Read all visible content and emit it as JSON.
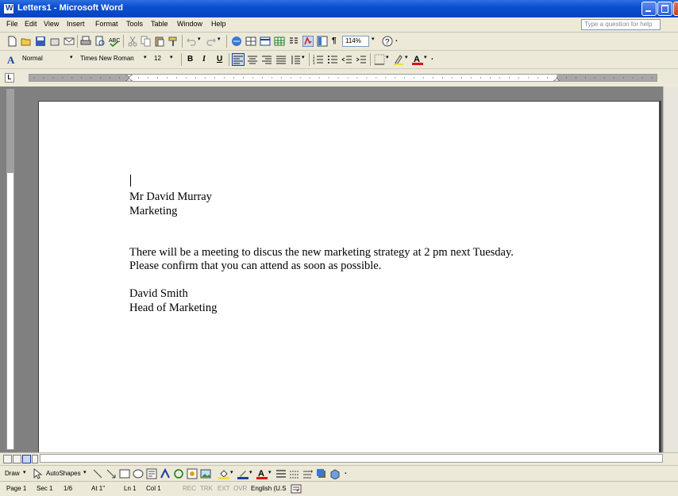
{
  "window": {
    "title": "Letters1 - Microsoft Word"
  },
  "menu": {
    "items": [
      "File",
      "Edit",
      "View",
      "Insert",
      "Format",
      "Tools",
      "Table",
      "Window",
      "Help"
    ],
    "help_placeholder": "Type a question for help"
  },
  "standard_toolbar": {
    "zoom": "114%"
  },
  "formatting_toolbar": {
    "style": "Normal",
    "font": "Times New Roman",
    "size": "12",
    "bold": "B",
    "italic": "I",
    "underline": "U"
  },
  "document": {
    "lines": [
      "Mr David Murray",
      "Marketing",
      "There will be a meeting to discus the new marketing strategy at 2 pm next Tuesday.",
      "Please confirm that you can attend as soon as possible.",
      "David Smith",
      "Head of Marketing"
    ]
  },
  "draw_toolbar": {
    "draw_label": "Draw",
    "autoshapes_label": "AutoShapes"
  },
  "status": {
    "page": "Page 1",
    "sec": "Sec 1",
    "pages": "1/6",
    "at": "At 1\"",
    "ln": "Ln 1",
    "col": "Col 1",
    "rec": "REC",
    "trk": "TRK",
    "ext": "EXT",
    "ovr": "OVR",
    "language": "English (U.S"
  },
  "icons": {
    "app": "word-icon",
    "new": "new-document-icon",
    "open": "open-folder-icon",
    "save": "save-icon",
    "print": "print-icon",
    "spelling": "spelling-icon",
    "undo": "undo-icon",
    "redo": "redo-icon",
    "help": "help-icon",
    "align": "align-left-icon",
    "cursor": "select-arrow-icon"
  },
  "colors": {
    "titlebar": "#0a4fd0",
    "close": "#c8401a",
    "font_color_red": "#e01010",
    "page_bg": "#ffffff",
    "workspace": "#808080"
  }
}
